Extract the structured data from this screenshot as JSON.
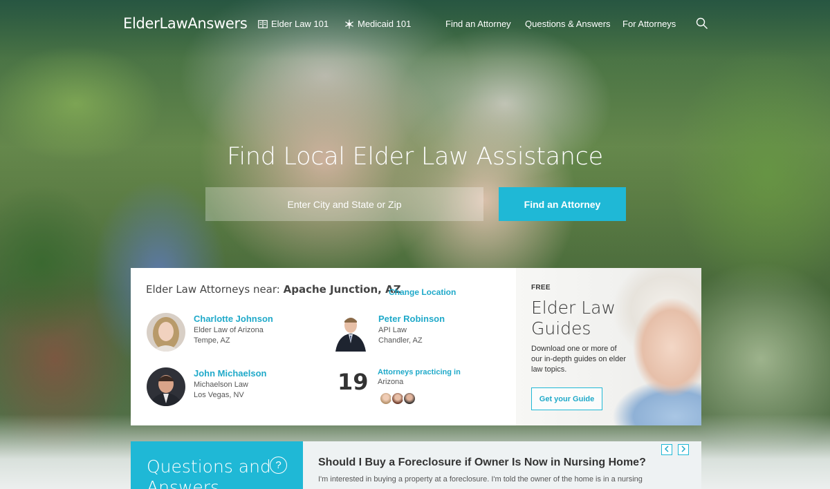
{
  "brand": {
    "logo_text": "ElderLawAnswers",
    "accent": "#1fb8d6"
  },
  "nav": {
    "items": [
      {
        "label": "Elder Law 101",
        "icon": "book-icon"
      },
      {
        "label": "Medicaid 101",
        "icon": "snowflake-icon"
      },
      {
        "label": "Find an Attorney"
      },
      {
        "label": "Questions & Answers"
      },
      {
        "label": "For Attorneys"
      }
    ],
    "search_icon": "search-icon"
  },
  "hero": {
    "title": "Find Local Elder Law Assistance",
    "search_placeholder": "Enter City and State or Zip",
    "button_label": "Find an Attorney"
  },
  "attorneys_card": {
    "heading_prefix": "Elder Law Attorneys near: ",
    "location": "Apache Junction, AZ",
    "change_location": "Change Location",
    "attorneys": [
      {
        "name": "Charlotte Johnson",
        "firm": "Elder Law of Arizona",
        "city": "Tempe, AZ"
      },
      {
        "name": "Peter Robinson",
        "firm": "API Law",
        "city": "Chandler, AZ"
      },
      {
        "name": "John Michaelson",
        "firm": "Michaelson Law",
        "city": "Los Vegas, NV"
      }
    ],
    "count": "19",
    "count_label": "Attorneys practicing in",
    "count_region": "Arizona"
  },
  "guides": {
    "eyebrow": "FREE",
    "title_line1": "Elder Law",
    "title_line2": "Guides",
    "description": "Download one or more of our in-depth guides on elder law topics.",
    "button_label": "Get your Guide"
  },
  "qa": {
    "section_title": "Questions and Answers",
    "question": "Should I Buy a Foreclosure if Owner Is Now in Nursing Home?",
    "excerpt": "I'm interested in buying a property at a foreclosure. I'm told the owner of the home is in a nursing"
  }
}
